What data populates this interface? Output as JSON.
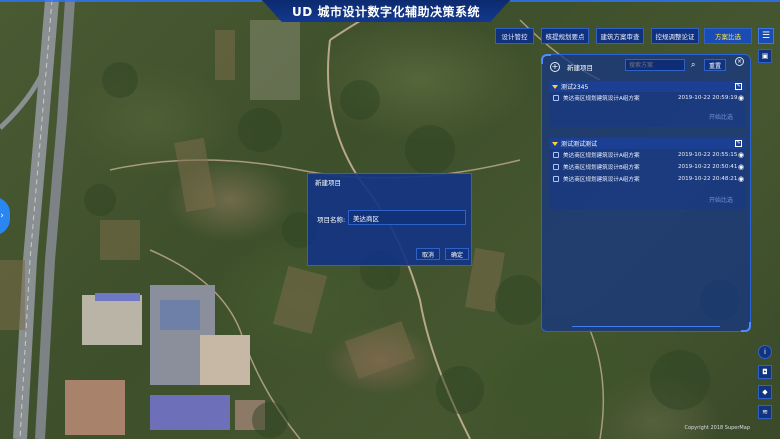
{
  "app": {
    "brand": "UD",
    "title": "城市设计数字化辅助决策系统"
  },
  "nav": [
    {
      "label": "设计管控",
      "active": false
    },
    {
      "label": "核提规划要点",
      "active": false
    },
    {
      "label": "建筑方案审查",
      "active": false
    },
    {
      "label": "控规调整论证",
      "active": false
    },
    {
      "label": "方案比选",
      "active": true
    }
  ],
  "panel": {
    "new_label": "新建项目",
    "search_placeholder": "搜索方案",
    "reset_label": "重置",
    "groups": [
      {
        "name": "测试2345",
        "items": [
          {
            "name": "美达商区规划建筑设计A组方案",
            "date": "2019-10-22 20:59:19"
          }
        ],
        "start_label": "开始比选"
      },
      {
        "name": "测试测试测试",
        "items": [
          {
            "name": "美达商区规划建筑设计A组方案",
            "date": "2019-10-22 20:55:15"
          },
          {
            "name": "美达商区规划建筑设计B组方案",
            "date": "2019-10-22 20:50:41"
          },
          {
            "name": "美达商区规划建筑设计A组方案",
            "date": "2019-10-22 20:48:21"
          }
        ],
        "start_label": "开始比选"
      }
    ]
  },
  "dialog": {
    "title": "新建项目",
    "field_label": "项目名称:",
    "field_value": "美达商区",
    "cancel_label": "取消",
    "ok_label": "确定"
  },
  "map": {
    "copyright": "Copyright 2018 SuperMap"
  },
  "icons": {
    "menu": "list-icon",
    "side_tools": [
      "info-icon",
      "camera-icon",
      "compass-icon",
      "layers-icon"
    ],
    "camera_top": "screenshot-icon"
  },
  "colors": {
    "accent": "#1a4db3",
    "active_text": "#ffe24a",
    "panel": "#133487"
  }
}
